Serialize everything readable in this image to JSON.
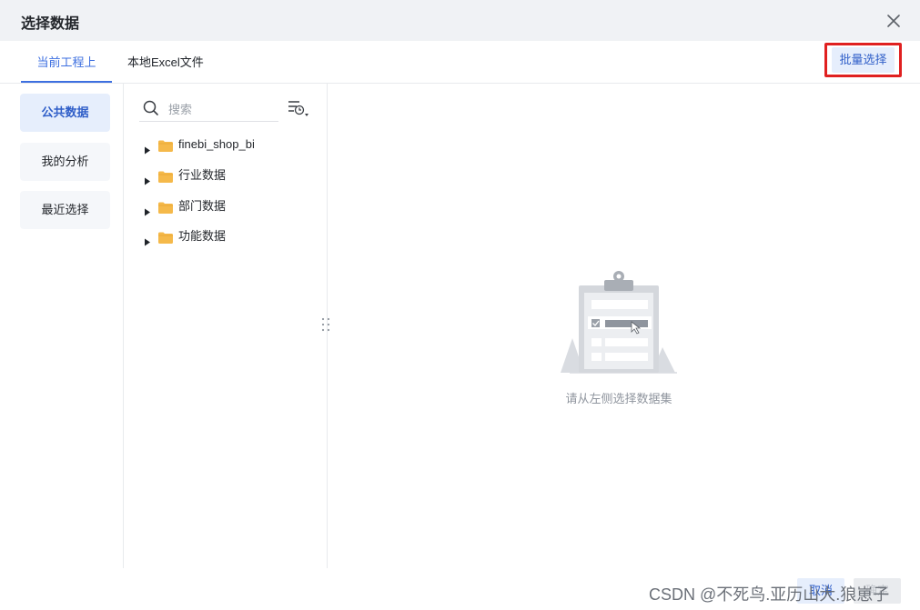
{
  "dialog": {
    "title": "选择数据"
  },
  "tabs": [
    {
      "label": "当前工程上"
    },
    {
      "label": "本地Excel文件"
    }
  ],
  "batch_select_label": "批量选择",
  "left_nav": [
    {
      "label": "公共数据"
    },
    {
      "label": "我的分析"
    },
    {
      "label": "最近选择"
    }
  ],
  "search": {
    "placeholder": "搜索",
    "value": ""
  },
  "tree": [
    {
      "label": "finebi_shop_bi"
    },
    {
      "label": "行业数据"
    },
    {
      "label": "部门数据"
    },
    {
      "label": "功能数据"
    }
  ],
  "empty_state": {
    "text": "请从左侧选择数据集"
  },
  "footer": {
    "cancel_label": "取消",
    "ok_label": "确定"
  },
  "watermark": "CSDN @不死鸟.亚历山大.狼崽子",
  "colors": {
    "accent": "#3d6fe0",
    "highlight_border": "#e02020",
    "folder": "#f5b94a"
  }
}
